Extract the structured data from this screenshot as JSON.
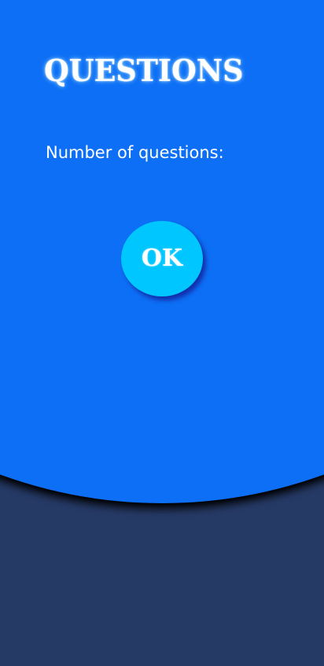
{
  "screen": {
    "title": "QUESTIONS",
    "question_count_label": "Number of questions:",
    "ok_button_label": "OK"
  },
  "colors": {
    "background_dark": "#263a66",
    "dome_blue": "#0d6ff5",
    "button_cyan": "#00c6ff",
    "text_white": "#ffffff"
  }
}
